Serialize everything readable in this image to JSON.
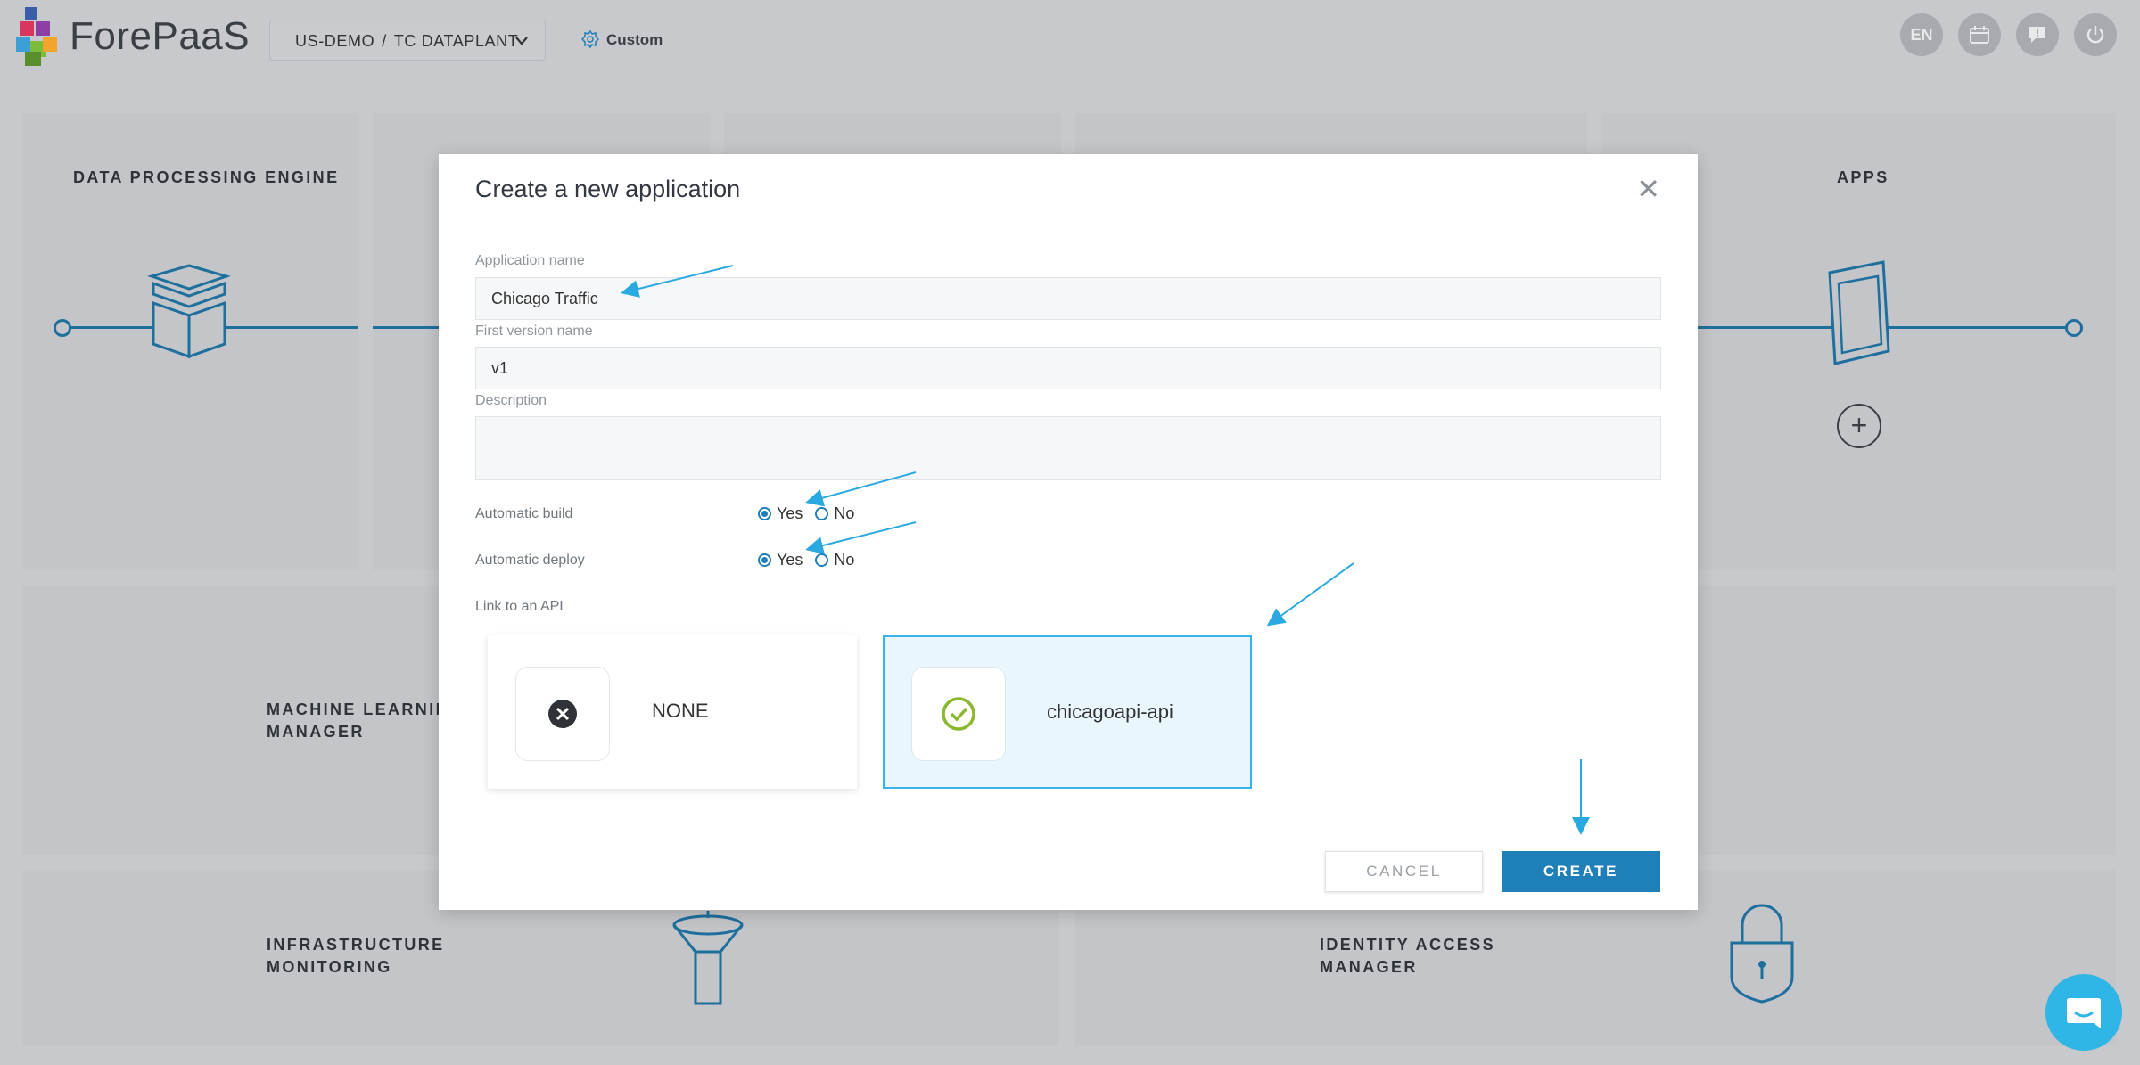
{
  "header": {
    "logo_text": "ForePaaS",
    "project": {
      "org": "US-DEMO",
      "separator": "/",
      "name": "TC DATAPLANT"
    },
    "custom_label": "Custom",
    "language": "EN"
  },
  "cards": {
    "data_processing_engine": "DATA PROCESSING ENGINE",
    "apps": "APPS",
    "machine_learning_manager": {
      "line1": "MACHINE LEARNING",
      "line2": "MANAGER"
    },
    "infrastructure_monitoring": {
      "line1": "INFRASTRUCTURE",
      "line2": "MONITORING"
    },
    "identity_access_manager": {
      "line1": "IDENTITY ACCESS",
      "line2": "MANAGER"
    }
  },
  "modal": {
    "title": "Create a new application",
    "fields": {
      "app_name_label": "Application name",
      "app_name_value": "Chicago Traffic",
      "version_label": "First version name",
      "version_value": "v1",
      "description_label": "Description",
      "description_value": ""
    },
    "automatic_build": {
      "label": "Automatic build",
      "yes": "Yes",
      "no": "No",
      "selected": "Yes"
    },
    "automatic_deploy": {
      "label": "Automatic deploy",
      "yes": "Yes",
      "no": "No",
      "selected": "Yes"
    },
    "link_api": {
      "label": "Link to an API",
      "options": [
        {
          "name": "NONE",
          "selected": false
        },
        {
          "name": "chicagoapi-api",
          "selected": true
        }
      ]
    },
    "buttons": {
      "cancel": "CANCEL",
      "create": "CREATE"
    }
  },
  "colors": {
    "primary": "#1f7fb8",
    "selected_border": "#34b5e5",
    "check_green": "#8ab82f",
    "annotation_arrow": "#2aa9e0"
  }
}
